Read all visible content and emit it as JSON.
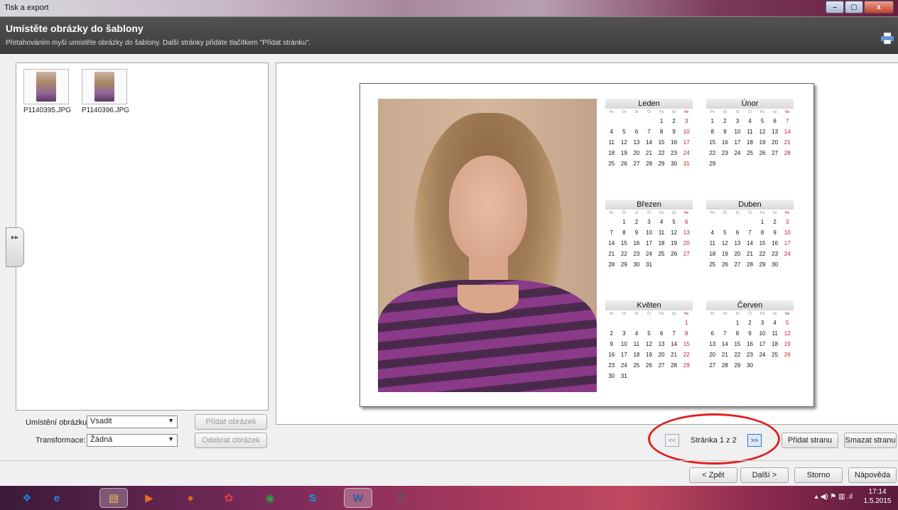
{
  "window": {
    "title": "Tisk a export",
    "minimize": "–",
    "maximize": "▢",
    "close": "x"
  },
  "header": {
    "title": "Umístěte obrázky do šablony",
    "subtitle": "Přetahováním myší umístěte obrázky do šablony. Další stránky přidáte tlačítkem \"Přidat stránku\"."
  },
  "thumbnails": [
    {
      "label": "P1140395.JPG"
    },
    {
      "label": "P1140396.JPG"
    }
  ],
  "side_handle": {
    "glyph": "▸▸"
  },
  "controls": {
    "placement_label": "Umístění obrázku:",
    "placement_value": "Vsadit",
    "transform_label": "Transformace:",
    "transform_value": "Žádná",
    "add_image": "Přidat obrázek",
    "remove_image": "Odebrat obrázek",
    "caret": "▼"
  },
  "calendar": {
    "weekdays": [
      "Po",
      "Út",
      "St",
      "Čt",
      "Pá",
      "So",
      "Ne"
    ],
    "months": [
      {
        "name": "Leden",
        "offset": 4,
        "days": 31
      },
      {
        "name": "Únor",
        "offset": 0,
        "days": 29
      },
      {
        "name": "Březen",
        "offset": 1,
        "days": 31
      },
      {
        "name": "Duben",
        "offset": 4,
        "days": 30
      },
      {
        "name": "Květen",
        "offset": 6,
        "days": 31
      },
      {
        "name": "Červen",
        "offset": 2,
        "days": 30
      }
    ]
  },
  "pagination": {
    "prev": "<<",
    "next": ">>",
    "label": "Stránka 1 z 2",
    "add_page": "Přidat stranu",
    "delete_page": "Smazat stranu"
  },
  "footer": {
    "back": "< Zpět",
    "next": "Další >",
    "cancel": "Storno",
    "help": "Nápověda"
  },
  "taskbar": {
    "icons": [
      {
        "name": "windows-start-icon",
        "glyph": "❖",
        "color": "#2a7ad0"
      },
      {
        "name": "internet-explorer-icon",
        "glyph": "e",
        "color": "#2a8ae0"
      },
      {
        "name": "file-explorer-icon",
        "glyph": "▤",
        "color": "#e8c050"
      },
      {
        "name": "media-player-icon",
        "glyph": "▶",
        "color": "#e07020"
      },
      {
        "name": "firefox-icon",
        "glyph": "●",
        "color": "#e06a10"
      },
      {
        "name": "photos-icon",
        "glyph": "✿",
        "color": "#e04040"
      },
      {
        "name": "chrome-icon",
        "glyph": "◉",
        "color": "#30a040"
      },
      {
        "name": "skype-icon",
        "glyph": "S",
        "color": "#10a0e0"
      },
      {
        "name": "word-icon",
        "glyph": "W",
        "color": "#2a5aa8"
      },
      {
        "name": "zoner-icon",
        "glyph": "Z",
        "color": "#506070"
      }
    ],
    "tray": "▴  ◀)  ⚑  ▥  .ıl",
    "time": "17:14",
    "date": "1.5.2015"
  }
}
